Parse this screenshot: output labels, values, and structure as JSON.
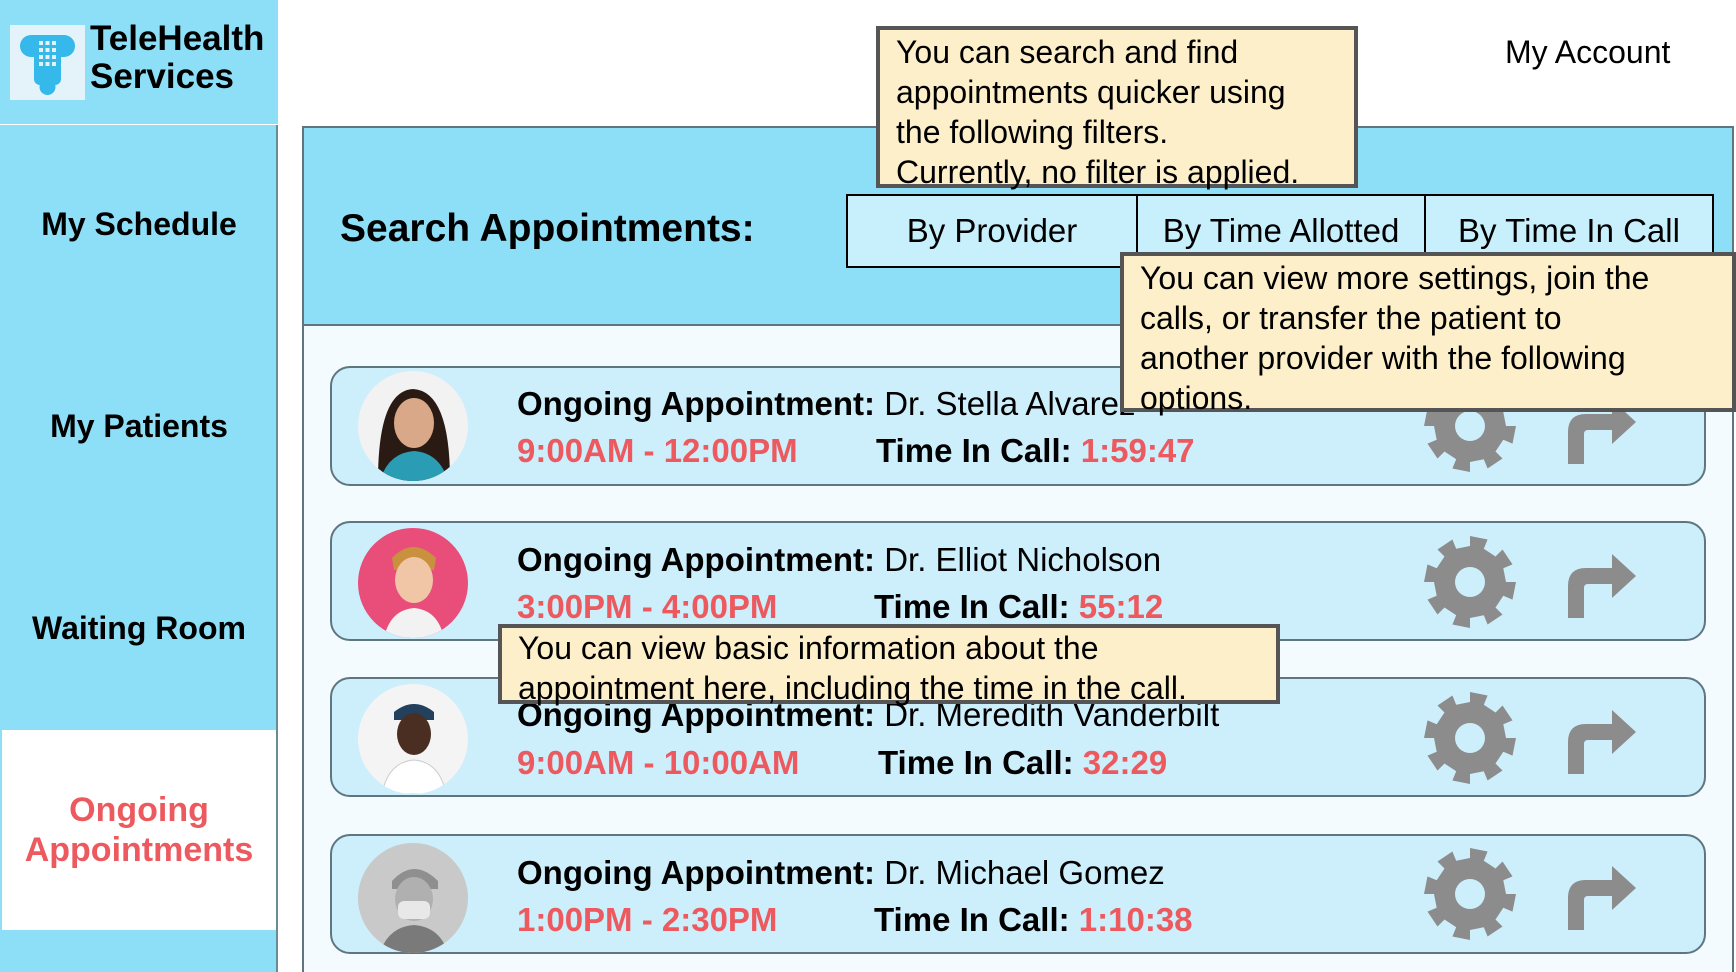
{
  "brand": {
    "line1": "TeleHealth",
    "line2": "Services"
  },
  "nav": {
    "my_schedule": "My Schedule",
    "my_patients": "My Patients",
    "waiting_room": "Waiting Room",
    "ongoing_line1": "Ongoing",
    "ongoing_line2": "Appointments"
  },
  "header": {
    "my_account": "My Account"
  },
  "search": {
    "label": "Search Appointments:",
    "filters": [
      "By Provider",
      "By Time Allotted",
      "By Time In Call"
    ]
  },
  "appointments": [
    {
      "label": "Ongoing Appointment:",
      "provider": "Dr. Stella Alvarez",
      "time": "9:00AM - 12:00PM",
      "call_label": "Time In Call:",
      "call_time": "1:59:47"
    },
    {
      "label": "Ongoing Appointment:",
      "provider": "Dr. Elliot Nicholson",
      "time": "3:00PM - 4:00PM",
      "call_label": "Time In Call:",
      "call_time": "55:12"
    },
    {
      "label": "Ongoing Appointment:",
      "provider": "Dr. Meredith Vanderbilt",
      "time": "9:00AM - 10:00AM",
      "call_label": "Time In Call:",
      "call_time": "32:29"
    },
    {
      "label": "Ongoing Appointment:",
      "provider": "Dr. Michael Gomez",
      "time": "1:00PM - 2:30PM",
      "call_label": "Time In Call:",
      "call_time": "1:10:38"
    }
  ],
  "tooltips": {
    "search": [
      "You can search and find",
      "appointments quicker using",
      "the following filters.",
      "Currently, no filter is applied."
    ],
    "actions": [
      "You can view more settings, join the",
      "calls, or transfer the patient to",
      "another provider with the following",
      "options."
    ],
    "info": [
      "You can view basic information about the",
      "appointment here, including the time in the call."
    ]
  },
  "colors": {
    "accent": "#ec5a5f",
    "sidebar": "#8ddff7",
    "card": "#cdeefb",
    "tooltip": "#fdefc9",
    "icon": "#8c8c8c"
  },
  "icons": [
    "stethoscope-logo-icon",
    "gear-icon",
    "forward-arrow-icon"
  ]
}
